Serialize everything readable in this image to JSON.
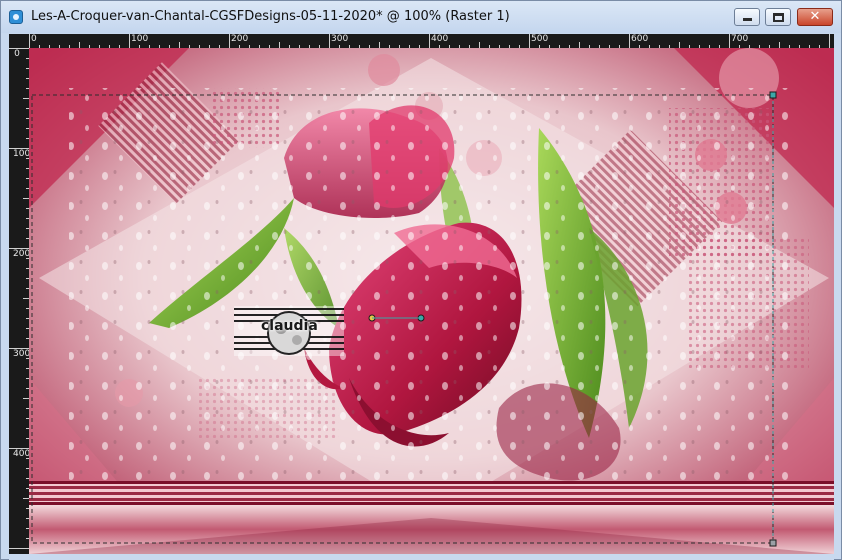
{
  "window": {
    "title": "Les-A-Croquer-van-Chantal-CGSFDesigns-05-11-2020* @ 100% (Raster 1)",
    "icons": {
      "app": "app-camera-icon",
      "minimize": "minimize-icon",
      "maximize": "maximize-icon",
      "close": "close-icon"
    },
    "close_glyph": "✕"
  },
  "rulers": {
    "top_labels": [
      "0",
      "100",
      "200",
      "300",
      "400",
      "500",
      "600",
      "700"
    ],
    "left_labels": [
      "0",
      "100",
      "200",
      "300",
      "400"
    ]
  },
  "canvas": {
    "watermark_text": "claudia",
    "colors": {
      "accent_pink": "#c41e52",
      "dark_red": "#7a0f2a",
      "leaf_green": "#7cbc3a",
      "pale_pink": "#f2d6da",
      "selection_teal": "#3aa7a7"
    }
  }
}
